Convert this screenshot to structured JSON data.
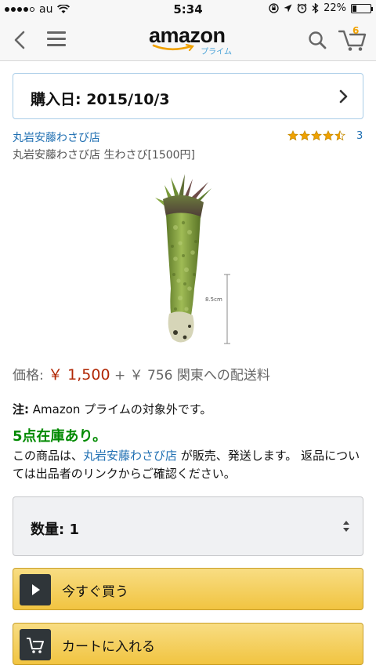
{
  "status_bar": {
    "carrier": "au",
    "time": "5:34",
    "battery_text": "22%",
    "battery_level": 0.22
  },
  "nav": {
    "logo_text": "amazon",
    "logo_sub": "プライム",
    "cart_count": "6",
    "icons": [
      "back-icon",
      "menu-icon",
      "search-icon",
      "cart-icon"
    ]
  },
  "purchase": {
    "label": "購入日: 2015/10/3"
  },
  "seller": {
    "name": "丸岩安藤わさび店",
    "rating": 4.5,
    "rating_count": "3"
  },
  "product": {
    "title": "丸岩安藤わさび店 生わさび[1500円]",
    "scale_label": "8.5cm"
  },
  "price": {
    "label": "価格: ",
    "value": "￥ 1,500",
    "shipping": " + ￥ 756 関東への配送料"
  },
  "note": {
    "label": "注:",
    "text": " Amazon プライムの対象外です。"
  },
  "stock": {
    "count": "5点",
    "text": "在庫あり。"
  },
  "seller_info": {
    "prefix": "この商品は、",
    "link": "丸岩安藤わさび店",
    "suffix": " が販売、発送します。 返品については出品者のリンクからご確認ください。"
  },
  "quantity": {
    "label": "数量: 1"
  },
  "buttons": {
    "buy_now": "今すぐ買う",
    "add_to_cart": "カートに入れる"
  },
  "colors": {
    "link": "#1f6fb2",
    "price": "#b12704",
    "stock": "#008a00",
    "button": "#f1c441",
    "star": "#f0a100"
  }
}
